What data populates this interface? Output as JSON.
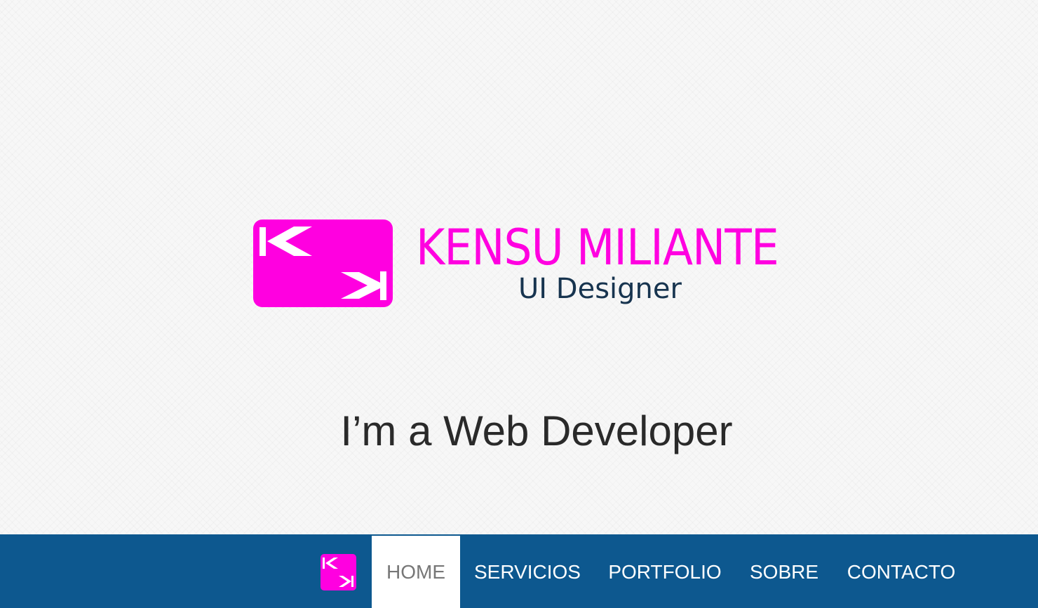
{
  "brand": {
    "name": "KENSU MILIANTE",
    "role": "UI Designer",
    "colors": {
      "magenta": "#ff00e0",
      "navy": "#0d588f",
      "role_text": "#17344f"
    }
  },
  "hero": {
    "tagline": "I’m a Web Developer"
  },
  "nav": {
    "logo_icon": "km-logo-icon",
    "items": [
      {
        "label": "HOME",
        "active": true
      },
      {
        "label": "SERVICIOS",
        "active": false
      },
      {
        "label": "PORTFOLIO",
        "active": false
      },
      {
        "label": "SOBRE",
        "active": false
      },
      {
        "label": "CONTACTO",
        "active": false
      }
    ]
  }
}
